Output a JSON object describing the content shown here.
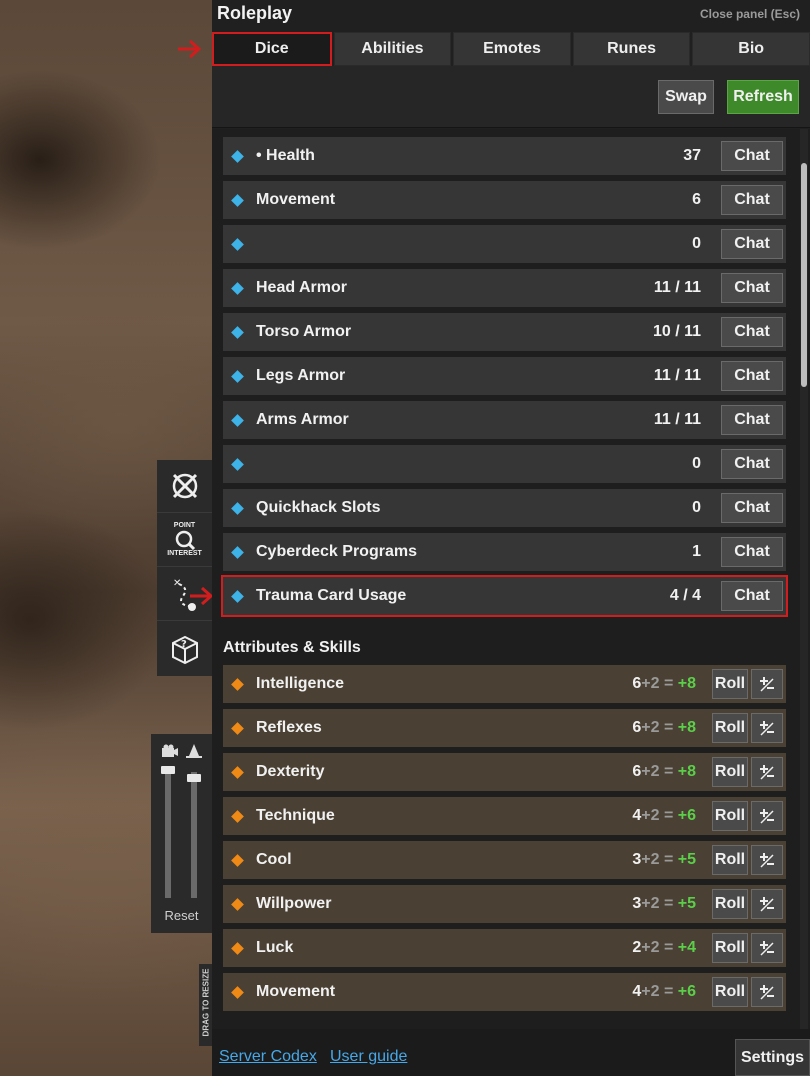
{
  "panel": {
    "title": "Roleplay",
    "close_label": "Close panel (Esc)"
  },
  "tabs": [
    {
      "label": "Dice",
      "active": true
    },
    {
      "label": "Abilities"
    },
    {
      "label": "Emotes"
    },
    {
      "label": "Runes"
    },
    {
      "label": "Bio"
    }
  ],
  "actions": {
    "swap_label": "Swap",
    "refresh_label": "Refresh"
  },
  "stats": [
    {
      "label": "• Health",
      "value": "37",
      "button": "Chat"
    },
    {
      "label": "Movement",
      "value": "6",
      "button": "Chat"
    },
    {
      "label": "",
      "value": "0",
      "button": "Chat"
    },
    {
      "label": "Head Armor",
      "value": "11 / 11",
      "button": "Chat"
    },
    {
      "label": "Torso Armor",
      "value": "10 / 11",
      "button": "Chat"
    },
    {
      "label": "Legs Armor",
      "value": "11 / 11",
      "button": "Chat"
    },
    {
      "label": "Arms Armor",
      "value": "11 / 11",
      "button": "Chat"
    },
    {
      "label": "",
      "value": "0",
      "button": "Chat"
    },
    {
      "label": "Quickhack Slots",
      "value": "0",
      "button": "Chat"
    },
    {
      "label": "Cyberdeck Programs",
      "value": "1",
      "button": "Chat"
    },
    {
      "label": "Trauma Card Usage",
      "value": "4 / 4",
      "button": "Chat",
      "highlighted": true
    }
  ],
  "attributes_section_title": "Attributes & Skills",
  "attributes": [
    {
      "label": "Intelligence",
      "base": "6",
      "mod": "+2",
      "eq": "=",
      "total": "+8",
      "button": "Roll"
    },
    {
      "label": "Reflexes",
      "base": "6",
      "mod": "+2",
      "eq": "=",
      "total": "+8",
      "button": "Roll"
    },
    {
      "label": "Dexterity",
      "base": "6",
      "mod": "+2",
      "eq": "=",
      "total": "+8",
      "button": "Roll"
    },
    {
      "label": "Technique",
      "base": "4",
      "mod": "+2",
      "eq": "=",
      "total": "+6",
      "button": "Roll"
    },
    {
      "label": "Cool",
      "base": "3",
      "mod": "+2",
      "eq": "=",
      "total": "+5",
      "button": "Roll"
    },
    {
      "label": "Willpower",
      "base": "3",
      "mod": "+2",
      "eq": "=",
      "total": "+5",
      "button": "Roll"
    },
    {
      "label": "Luck",
      "base": "2",
      "mod": "+2",
      "eq": "=",
      "total": "+4",
      "button": "Roll"
    },
    {
      "label": "Movement",
      "base": "4",
      "mod": "+2",
      "eq": "=",
      "total": "+6",
      "button": "Roll"
    }
  ],
  "footer": {
    "codex_link": "Server Codex",
    "guide_link": "User guide",
    "settings_label": "Settings"
  },
  "toolbar": {
    "poi_line1": "POINT",
    "poi_line2": "INTEREST",
    "reset_label": "Reset",
    "drag_label": "DRAG TO RESIZE"
  },
  "colors": {
    "accent_red": "#d11d1d",
    "refresh_green": "#3e8a2a",
    "stat_diamond": "#3db3e8",
    "attr_diamond": "#f08a16",
    "bonus_green": "#5ccf4a",
    "link_blue": "#46a8e8"
  }
}
